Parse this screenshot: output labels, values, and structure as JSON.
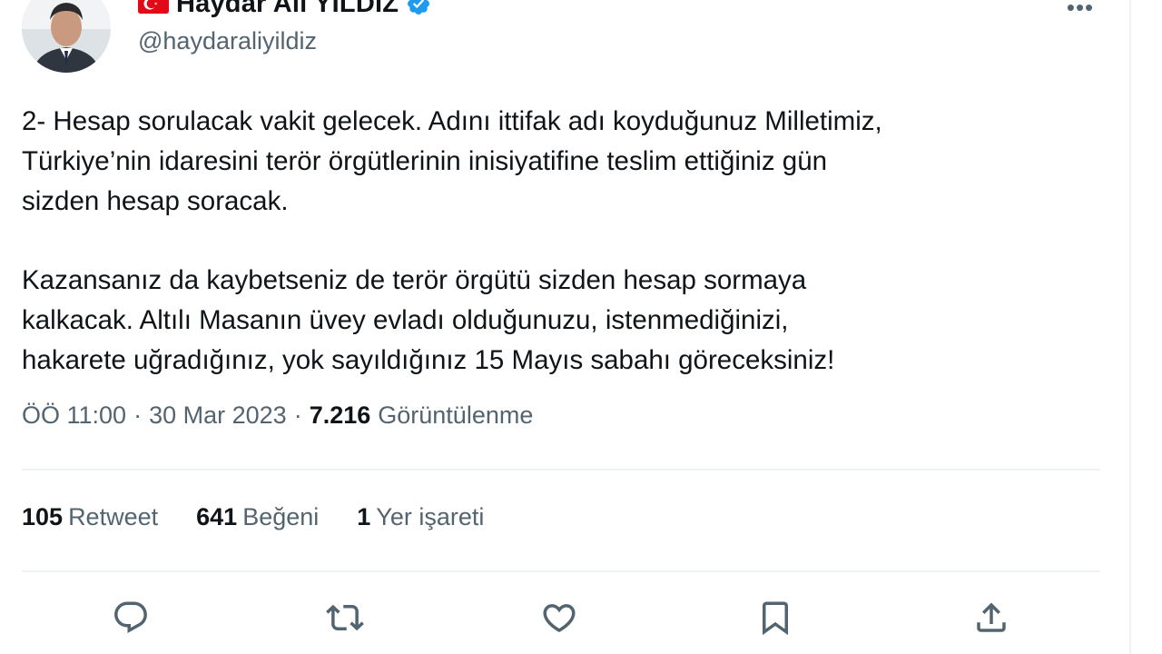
{
  "author": {
    "display_name": "Haydar Ali YILDIZ",
    "handle": "@haydaraliyildiz",
    "verified": true,
    "flag_icon": "turkey-flag-icon",
    "avatar_icon": "profile-photo-icon"
  },
  "tweet": {
    "paragraph_1": "2- Hesap sorulacak vakit gelecek. Adını ittifak adı koyduğunuz Milletimiz,\nTürkiye’nin idaresini terör örgütlerinin inisiyatifine teslim ettiğiniz gün\nsizden hesap soracak.",
    "paragraph_2": "Kazansanız da kaybetseniz de terör örgütü sizden hesap sormaya\nkalkacak. Altılı Masanın üvey evladı olduğunuzu, istenmediğinizi,\nhakarete uğradığınız, yok sayıldığınız 15 Mayıs sabahı göreceksiniz!"
  },
  "meta": {
    "time": "ÖÖ 11:00",
    "separator": "·",
    "date": "30 Mar 2023",
    "views_count": "7.216",
    "views_label": "Görüntülenme"
  },
  "stats": {
    "retweets_count": "105",
    "retweets_label": "Retweet",
    "likes_count": "641",
    "likes_label": "Beğeni",
    "bookmarks_count": "1",
    "bookmarks_label": "Yer işareti"
  },
  "actions": [
    "reply-icon",
    "retweet-icon",
    "like-icon",
    "bookmark-icon",
    "share-icon"
  ],
  "colors": {
    "text_primary": "#0f1419",
    "text_secondary": "#536471",
    "verified_blue": "#1d9bf0",
    "flag_red": "#e30a17",
    "divider": "#eff3f4"
  }
}
